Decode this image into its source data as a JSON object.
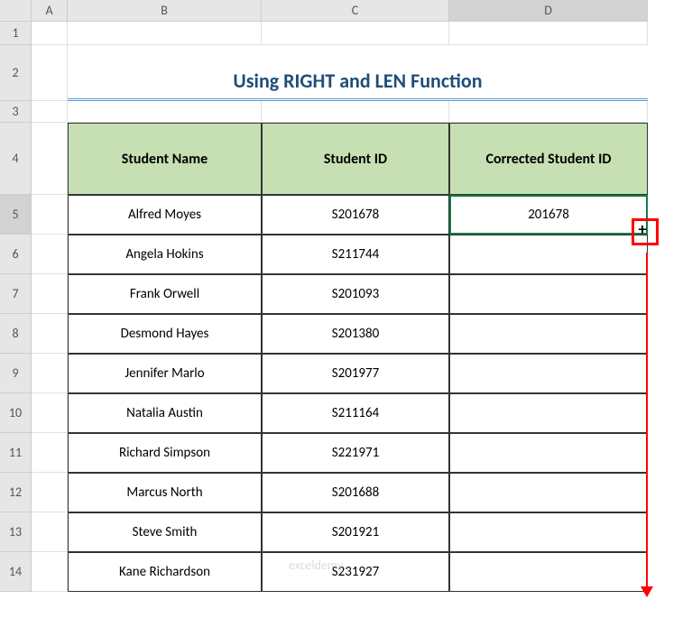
{
  "columns": [
    "A",
    "B",
    "C",
    "D"
  ],
  "rows": [
    "1",
    "2",
    "3",
    "4",
    "5",
    "6",
    "7",
    "8",
    "9",
    "10",
    "11",
    "12",
    "13",
    "14"
  ],
  "title": "Using RIGHT and LEN Function",
  "headers": {
    "name": "Student Name",
    "id": "Student ID",
    "corrected": "Corrected Student ID"
  },
  "data": [
    {
      "name": "Alfred Moyes",
      "id": "S201678",
      "corrected": "201678"
    },
    {
      "name": "Angela Hokins",
      "id": "S211744",
      "corrected": ""
    },
    {
      "name": "Frank Orwell",
      "id": "S201093",
      "corrected": ""
    },
    {
      "name": "Desmond Hayes",
      "id": "S201380",
      "corrected": ""
    },
    {
      "name": "Jennifer Marlo",
      "id": "S201977",
      "corrected": ""
    },
    {
      "name": "Natalia Austin",
      "id": "S211164",
      "corrected": ""
    },
    {
      "name": "Richard Simpson",
      "id": "S221971",
      "corrected": ""
    },
    {
      "name": "Marcus North",
      "id": "S201688",
      "corrected": ""
    },
    {
      "name": "Steve Smith",
      "id": "S201921",
      "corrected": ""
    },
    {
      "name": "Kane Richardson",
      "id": "S231927",
      "corrected": ""
    }
  ],
  "watermark": "exceldemy",
  "selected_column": "D",
  "selected_row": "5"
}
